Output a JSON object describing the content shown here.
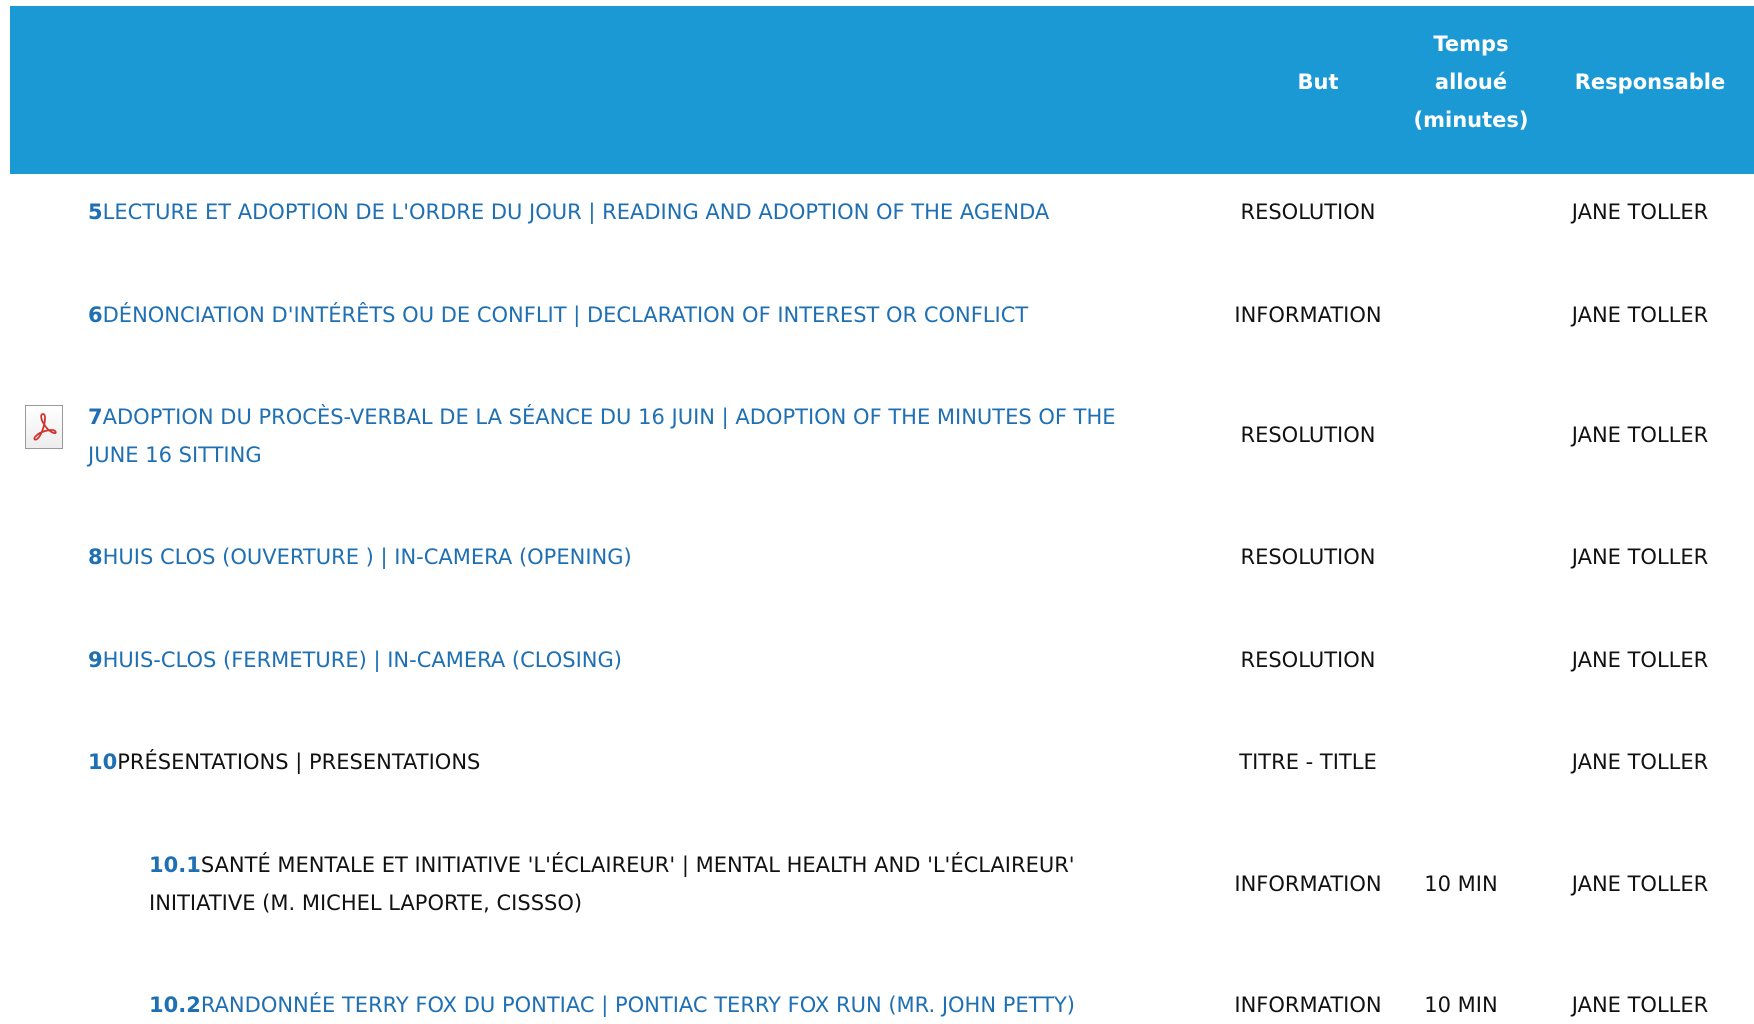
{
  "header": {
    "but": "But",
    "temps": [
      "Temps",
      "alloué",
      "(minutes)"
    ],
    "responsable": "Responsable"
  },
  "rows": [
    {
      "num": "5",
      "title": "LECTURE ET ADOPTION DE L'ORDRE DU JOUR | READING AND ADOPTION OF THE AGENDA",
      "but": "RESOLUTION",
      "temps": "",
      "resp": "JANE TOLLER"
    },
    {
      "num": "6",
      "title": "DÉNONCIATION D'INTÉRÊTS OU DE CONFLIT | DECLARATION OF INTEREST OR CONFLICT",
      "but": "INFORMATION",
      "temps": "",
      "resp": "JANE TOLLER"
    },
    {
      "num": "7",
      "title_line1": "ADOPTION DU PROCÈS-VERBAL DE LA SÉANCE DU 16 JUIN | ADOPTION OF THE MINUTES OF THE",
      "title_line2": "JUNE 16 SITTING",
      "but": "RESOLUTION",
      "temps": "",
      "resp": "JANE TOLLER",
      "icon": "pdf-icon"
    },
    {
      "num": "8",
      "title": "HUIS CLOS (OUVERTURE ) | IN-CAMERA (OPENING)",
      "but": "RESOLUTION",
      "temps": "",
      "resp": "JANE TOLLER"
    },
    {
      "num": "9",
      "title": "HUIS-CLOS (FERMETURE) | IN-CAMERA (CLOSING)",
      "but": "RESOLUTION",
      "temps": "",
      "resp": "JANE TOLLER"
    },
    {
      "num": "10",
      "title": "PRÉSENTATIONS | PRESENTATIONS",
      "but": "TITRE - TITLE",
      "temps": "",
      "resp": "JANE TOLLER"
    },
    {
      "num": "10.1",
      "title_line1": "SANTÉ MENTALE ET INITIATIVE 'L'ÉCLAIREUR' | MENTAL HEALTH AND 'L'ÉCLAIREUR'",
      "title_line2": "INITIATIVE (M. MICHEL LAPORTE, CISSSO)",
      "but": "INFORMATION",
      "temps": "10 MIN",
      "resp": "JANE TOLLER"
    },
    {
      "num": "10.2",
      "title": "RANDONNÉE TERRY FOX DU PONTIAC | PONTIAC TERRY FOX RUN (MR. JOHN PETTY)",
      "but": "INFORMATION",
      "temps": "10 MIN",
      "resp": "JANE TOLLER"
    }
  ],
  "colors": {
    "header_bg": "#1a99d5",
    "link": "#1f6fb3"
  }
}
